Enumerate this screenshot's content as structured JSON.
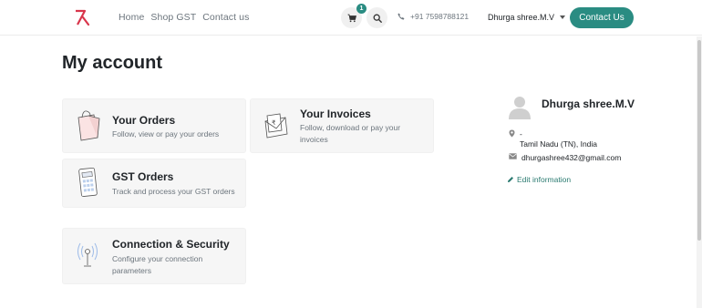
{
  "navbar": {
    "links": [
      "Home",
      "Shop GST",
      "Contact us"
    ],
    "cart_count": "1",
    "phone": "+91 7598788121",
    "user_name": "Dhurga shree.M.V",
    "contact_button": "Contact Us"
  },
  "page": {
    "title": "My account"
  },
  "cards": [
    {
      "title": "Your Orders",
      "desc": "Follow, view or pay your orders",
      "icon": "shopping-bag-icon"
    },
    {
      "title": "Your Invoices",
      "desc": "Follow, download or pay your invoices",
      "icon": "invoice-envelope-icon"
    },
    {
      "title": "GST Orders",
      "desc": "Track and process your GST orders",
      "icon": "calculator-icon"
    },
    {
      "title": "Connection & Security",
      "desc": "Configure your connection parameters",
      "icon": "antenna-icon"
    }
  ],
  "profile": {
    "name": "Dhurga shree.M.V",
    "address_line1": "-",
    "address_line2": "Tamil Nadu (TN), India",
    "email": "dhurgashree432@gmail.com",
    "edit_label": "Edit information"
  },
  "colors": {
    "accent": "#2a8c82",
    "card_bg": "#f6f6f6",
    "muted": "#6c757d"
  }
}
